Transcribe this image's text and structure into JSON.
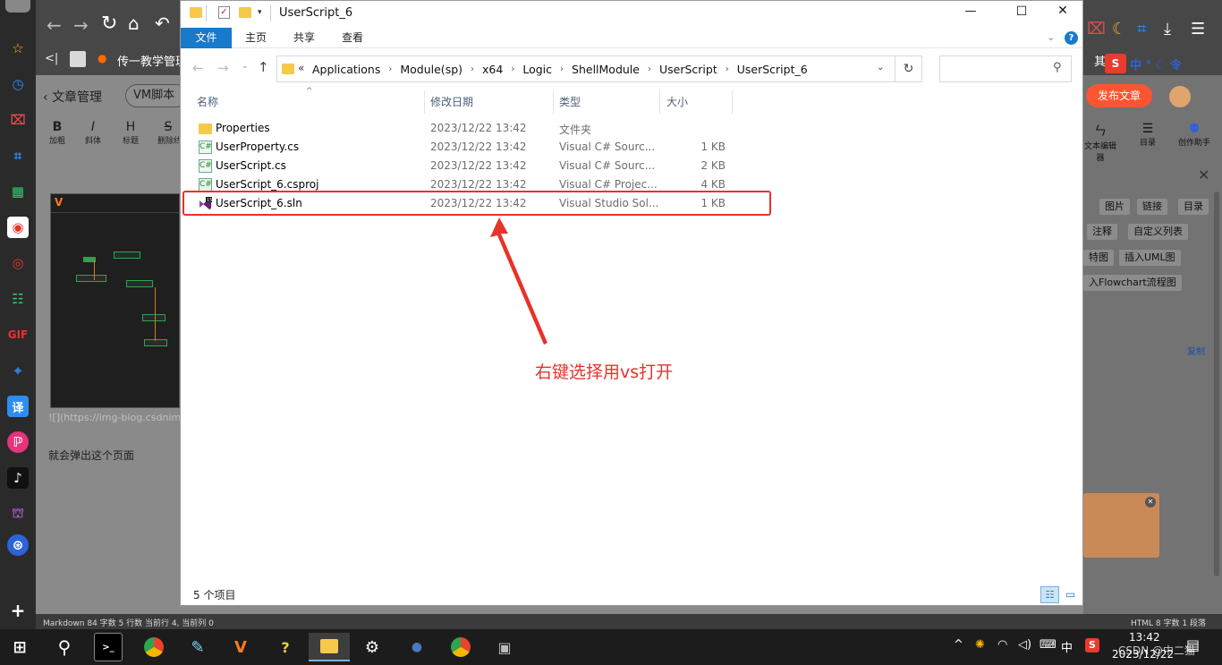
{
  "window": {
    "title": "UserScript_6",
    "minimize": "—",
    "maximize": "☐",
    "close": "✕"
  },
  "ribbon": {
    "tabs": [
      "文件",
      "主页",
      "共享",
      "查看"
    ]
  },
  "address": {
    "prefix": "«",
    "crumbs": [
      "Applications",
      "Module(sp)",
      "x64",
      "Logic",
      "ShellModule",
      "UserScript",
      "UserScript_6"
    ],
    "search_placeholder": ""
  },
  "columns": {
    "name": "名称",
    "date": "修改日期",
    "type": "类型",
    "size": "大小"
  },
  "files": [
    {
      "name": "Properties",
      "date": "2023/12/22 13:42",
      "type": "文件夹",
      "size": "",
      "icon": "folder-icon"
    },
    {
      "name": "UserProperty.cs",
      "date": "2023/12/22 13:42",
      "type": "Visual C# Sourc...",
      "size": "1 KB",
      "icon": "csharp-file-icon"
    },
    {
      "name": "UserScript.cs",
      "date": "2023/12/22 13:42",
      "type": "Visual C# Sourc...",
      "size": "2 KB",
      "icon": "csharp-file-icon"
    },
    {
      "name": "UserScript_6.csproj",
      "date": "2023/12/22 13:42",
      "type": "Visual C# Projec...",
      "size": "4 KB",
      "icon": "csproj-file-icon"
    },
    {
      "name": "UserScript_6.sln",
      "date": "2023/12/22 13:42",
      "type": "Visual Studio Sol...",
      "size": "1 KB",
      "icon": "vs-solution-icon"
    }
  ],
  "status": {
    "count": "5 个项目"
  },
  "annotation": {
    "text": "右键选择用vs打开",
    "color": "#e8322a"
  },
  "background_page": {
    "breadcrumb": "文章管理",
    "tab": "VM脚本",
    "bookmark": "传一教学管理",
    "bookmark_right": "其",
    "publish_button": "发布文章",
    "toolbar": [
      {
        "glyph": "B",
        "label": "加粗"
      },
      {
        "glyph": "I",
        "label": "斜体"
      },
      {
        "glyph": "H",
        "label": "标题"
      },
      {
        "glyph": "S",
        "label": "删除线"
      }
    ],
    "right_toolbar": [
      {
        "label": "文本编辑器"
      },
      {
        "label": "目录"
      },
      {
        "label": "创作助手"
      }
    ],
    "chips": [
      "图片",
      "链接",
      "目录",
      "注释",
      "自定义列表",
      "特图",
      "插入UML图",
      "入Flowchart流程图"
    ],
    "copy_label": "复制",
    "image_link": "![](https://img-blog.csdnim",
    "paragraph": "就会弹出这个页面",
    "status_left": "Markdown  84 字数  5 行数  当前行 4, 当前列 0",
    "status_right": "HTML  8 字数  1 段落"
  },
  "taskbar": {
    "time": "13:42",
    "date": "2023/12/22",
    "ime": "中",
    "watermark": "CSDN @中二猫",
    "ime_bar": "中 ° ☾ 令"
  },
  "colors": {
    "explorer_accent": "#1979ca",
    "selection_box": "#e8322a",
    "publish": "#fc5531"
  }
}
